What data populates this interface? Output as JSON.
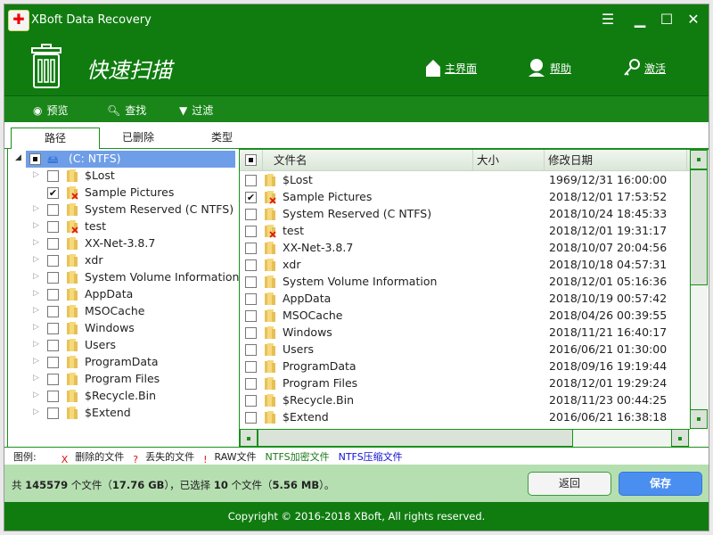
{
  "app": {
    "title": "XBoft Data Recovery"
  },
  "header": {
    "title": "快速扫描",
    "nav": [
      {
        "label": "主界面",
        "icon": "home-icon"
      },
      {
        "label": "帮助",
        "icon": "support-icon"
      },
      {
        "label": "激活",
        "icon": "key-icon"
      }
    ]
  },
  "toolbar": [
    {
      "label": "预览",
      "icon": "eye-icon"
    },
    {
      "label": "查找",
      "icon": "search-icon"
    },
    {
      "label": "过滤",
      "icon": "filter-icon"
    }
  ],
  "tabs": [
    {
      "label": "路径",
      "active": true
    },
    {
      "label": "已删除"
    },
    {
      "label": "类型"
    }
  ],
  "tree": {
    "root": "(C: NTFS)",
    "items": [
      {
        "name": "$Lost",
        "checked": false,
        "deleted": false,
        "expandable": true
      },
      {
        "name": "Sample Pictures",
        "checked": true,
        "deleted": true,
        "expandable": false
      },
      {
        "name": "System Reserved (C NTFS)",
        "checked": false,
        "deleted": false,
        "expandable": true
      },
      {
        "name": "test",
        "checked": false,
        "deleted": true,
        "expandable": true
      },
      {
        "name": "XX-Net-3.8.7",
        "checked": false,
        "deleted": false,
        "expandable": true
      },
      {
        "name": "xdr",
        "checked": false,
        "deleted": false,
        "expandable": true
      },
      {
        "name": "System Volume Information",
        "checked": false,
        "deleted": false,
        "expandable": true
      },
      {
        "name": "AppData",
        "checked": false,
        "deleted": false,
        "expandable": true
      },
      {
        "name": "MSOCache",
        "checked": false,
        "deleted": false,
        "expandable": true
      },
      {
        "name": "Windows",
        "checked": false,
        "deleted": false,
        "expandable": true
      },
      {
        "name": "Users",
        "checked": false,
        "deleted": false,
        "expandable": true
      },
      {
        "name": "ProgramData",
        "checked": false,
        "deleted": false,
        "expandable": true
      },
      {
        "name": "Program Files",
        "checked": false,
        "deleted": false,
        "expandable": true
      },
      {
        "name": "$Recycle.Bin",
        "checked": false,
        "deleted": false,
        "expandable": true
      },
      {
        "name": "$Extend",
        "checked": false,
        "deleted": false,
        "expandable": true
      }
    ]
  },
  "list": {
    "columns": [
      "文件名",
      "大小",
      "修改日期"
    ],
    "rows": [
      {
        "name": "$Lost",
        "date": "1969/12/31 16:00:00",
        "checked": false,
        "deleted": false
      },
      {
        "name": "Sample Pictures",
        "date": "2018/12/01 17:53:52",
        "checked": true,
        "deleted": true
      },
      {
        "name": "System Reserved (C NTFS)",
        "date": "2018/10/24 18:45:33",
        "checked": false,
        "deleted": false
      },
      {
        "name": "test",
        "date": "2018/12/01 19:31:17",
        "checked": false,
        "deleted": true
      },
      {
        "name": "XX-Net-3.8.7",
        "date": "2018/10/07 20:04:56",
        "checked": false,
        "deleted": false
      },
      {
        "name": "xdr",
        "date": "2018/10/18 04:57:31",
        "checked": false,
        "deleted": false
      },
      {
        "name": "System Volume Information",
        "date": "2018/12/01 05:16:36",
        "checked": false,
        "deleted": false
      },
      {
        "name": "AppData",
        "date": "2018/10/19 00:57:42",
        "checked": false,
        "deleted": false
      },
      {
        "name": "MSOCache",
        "date": "2018/04/26 00:39:55",
        "checked": false,
        "deleted": false
      },
      {
        "name": "Windows",
        "date": "2018/11/21 16:40:17",
        "checked": false,
        "deleted": false
      },
      {
        "name": "Users",
        "date": "2016/06/21 01:30:00",
        "checked": false,
        "deleted": false
      },
      {
        "name": "ProgramData",
        "date": "2018/09/16 19:19:44",
        "checked": false,
        "deleted": false
      },
      {
        "name": "Program Files",
        "date": "2018/12/01 19:29:24",
        "checked": false,
        "deleted": false
      },
      {
        "name": "$Recycle.Bin",
        "date": "2018/11/23 00:44:25",
        "checked": false,
        "deleted": false
      },
      {
        "name": "$Extend",
        "date": "2016/06/21 16:38:18",
        "checked": false,
        "deleted": false
      }
    ]
  },
  "legend": {
    "label": "图例:",
    "items": [
      {
        "mark": "X",
        "text": "删除的文件",
        "mark_color": "#e01010"
      },
      {
        "mark": "?",
        "text": "丢失的文件",
        "mark_color": "#e01010"
      },
      {
        "mark": "!",
        "text": "RAW文件",
        "mark_color": "#e01010"
      },
      {
        "mark": "",
        "text": "NTFS加密文件",
        "color": "#1a7a1a"
      },
      {
        "mark": "",
        "text": "NTFS压缩文件",
        "color": "#1010d0"
      }
    ]
  },
  "status": {
    "prefix": "共 ",
    "total_files": "145579",
    "mid1": " 个文件（",
    "total_size": "17.76 GB",
    "mid2": "），已选择 ",
    "selected_files": "10",
    "mid3": " 个文件（",
    "selected_size": "5.56 MB",
    "suffix": "）。"
  },
  "buttons": {
    "back": "返回",
    "save": "保存"
  },
  "footer": "Copyright © 2016-2018 XBoft, All rights reserved.",
  "colors": {
    "brand_green": "#107c10",
    "status_bg": "#b6dfb1",
    "save_blue": "#4a8ef0",
    "selection": "#6f9ee8"
  }
}
